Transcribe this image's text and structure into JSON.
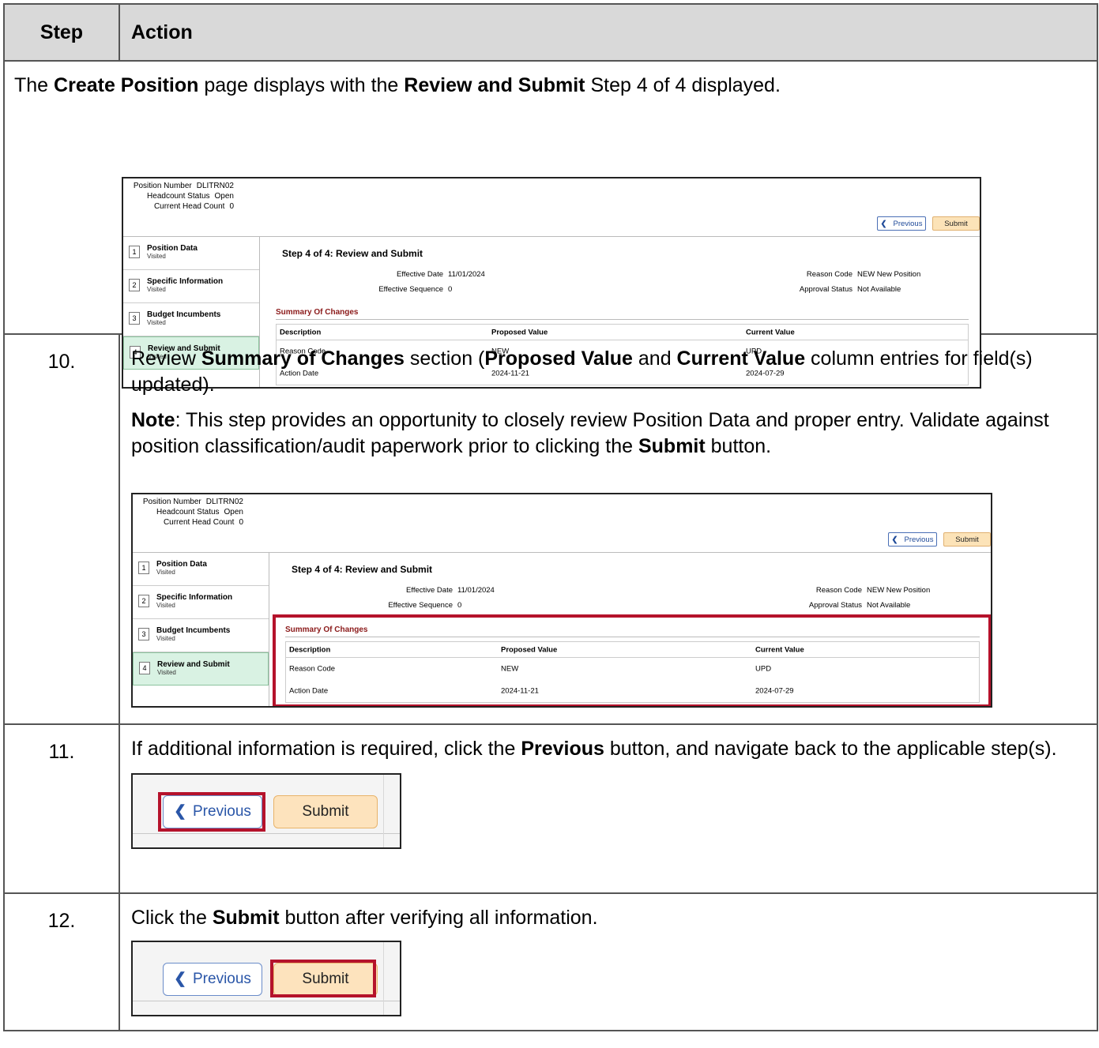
{
  "table": {
    "header_step": "Step",
    "header_action": "Action",
    "intro": {
      "t1": "The ",
      "b1": "Create Position",
      "t2": " page displays with the ",
      "b2": "Review and Submit",
      "t3": " Step 4 of 4 displayed."
    },
    "step10": {
      "number": "10.",
      "t1": "Review ",
      "b1": "Summary of Changes",
      "t2": " section (",
      "b2": "Proposed Value",
      "t3": " and ",
      "b3": "Current Value",
      "t4": " column entries for field(s) updated).",
      "note_label": "Note",
      "note_text1": ": This step provides an opportunity to closely review Position Data and proper entry. Validate against position classification/audit paperwork prior to clicking the ",
      "note_bold": "Submit",
      "note_text2": " button."
    },
    "step11": {
      "number": "11.",
      "t1": "If additional information is required, click the ",
      "b1": "Previous",
      "t2": " button, and navigate back to the applicable step(s)."
    },
    "step12": {
      "number": "12.",
      "t1": "Click the ",
      "b1": "Submit",
      "t2": " button after verifying all information."
    }
  },
  "screen": {
    "header": {
      "position_number_label": "Position Number",
      "position_number_value": "DLITRN02",
      "headcount_status_label": "Headcount Status",
      "headcount_status_value": "Open",
      "current_head_count_label": "Current Head Count",
      "current_head_count_value": "0"
    },
    "previous_label": "Previous",
    "submit_label": "Submit",
    "steps": [
      {
        "num": "1",
        "title": "Position Data",
        "status": "Visited"
      },
      {
        "num": "2",
        "title": "Specific Information",
        "status": "Visited"
      },
      {
        "num": "3",
        "title": "Budget Incumbents",
        "status": "Visited"
      },
      {
        "num": "4",
        "title": "Review and Submit",
        "status": "Visited"
      }
    ],
    "main_title": "Step 4 of 4: Review and Submit",
    "effective_date_label": "Effective Date",
    "effective_date_value": "11/01/2024",
    "effective_sequence_label": "Effective Sequence",
    "effective_sequence_value": "0",
    "reason_code_label": "Reason Code",
    "reason_code_value": "NEW  New Position",
    "approval_status_label": "Approval Status",
    "approval_status_value": "Not Available",
    "summary_title": "Summary Of Changes",
    "columns": [
      "Description",
      "Proposed Value",
      "Current Value"
    ],
    "rows": [
      [
        "Reason Code",
        "NEW",
        "UPD"
      ],
      [
        "Action Date",
        "2024-11-21",
        "2024-07-29"
      ]
    ]
  },
  "colors": {
    "highlight_red": "#b5122b",
    "active_step_green": "#d9f2e3",
    "submit_orange": "#fce3b8"
  }
}
